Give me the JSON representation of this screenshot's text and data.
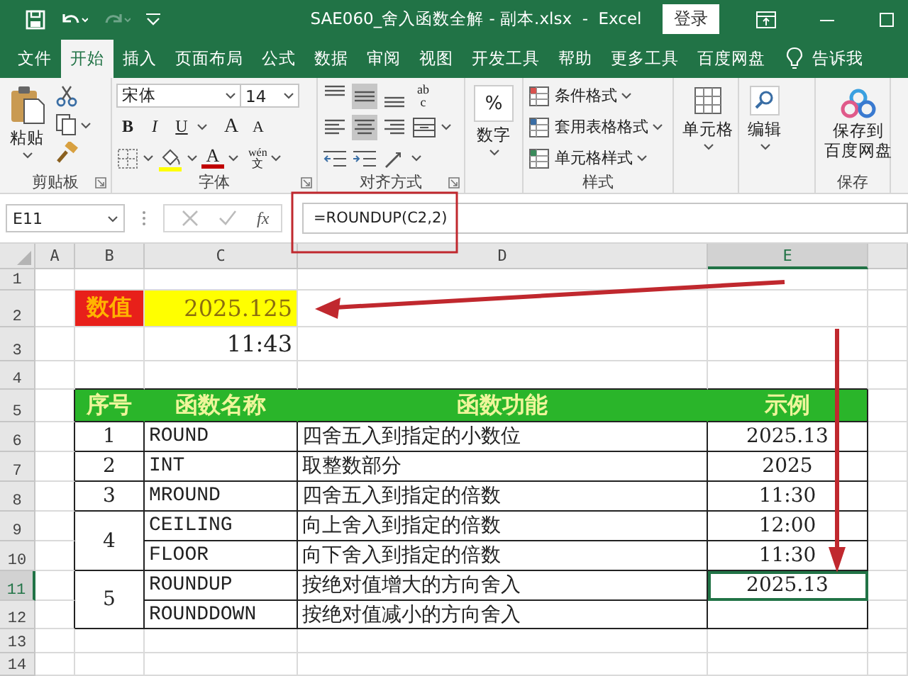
{
  "title_bar": {
    "title": "SAE060_舍入函数全解 - 副本.xlsx  -  Excel",
    "login": "登录"
  },
  "tabs": [
    {
      "label": "文件",
      "selected": false
    },
    {
      "label": "开始",
      "selected": true
    },
    {
      "label": "插入",
      "selected": false
    },
    {
      "label": "页面布局",
      "selected": false
    },
    {
      "label": "公式",
      "selected": false
    },
    {
      "label": "数据",
      "selected": false
    },
    {
      "label": "审阅",
      "selected": false
    },
    {
      "label": "视图",
      "selected": false
    },
    {
      "label": "开发工具",
      "selected": false
    },
    {
      "label": "帮助",
      "selected": false
    },
    {
      "label": "更多工具",
      "selected": false
    },
    {
      "label": "百度网盘",
      "selected": false
    }
  ],
  "tell_me": "告诉我",
  "ribbon": {
    "clipboard": {
      "paste": "粘贴",
      "label": "剪贴板"
    },
    "font": {
      "name": "宋体",
      "size": "14",
      "bold": "B",
      "italic": "I",
      "underline": "U",
      "grow": "A",
      "shrink": "A",
      "font_color": "A",
      "phonetic_top": "wén",
      "phonetic_bottom": "文",
      "label": "字体"
    },
    "alignment": {
      "wrap_top": "ab",
      "wrap_bottom": "c",
      "label": "对齐方式"
    },
    "number": {
      "symbol": "%",
      "button": "数字"
    },
    "styles": {
      "items": [
        "条件格式",
        "套用表格格式",
        "单元格样式"
      ],
      "label": "样式"
    },
    "cells": {
      "button": "单元格"
    },
    "editing": {
      "button": "编辑"
    },
    "save": {
      "button_lines": [
        "保存到",
        "百度网盘"
      ],
      "label": "保存"
    }
  },
  "formula_bar": {
    "name_box": "E11",
    "fx": "fx",
    "formula": "=ROUNDUP(C2,2)"
  },
  "sheet": {
    "columns": [
      {
        "label": "A",
        "selected": false
      },
      {
        "label": "B",
        "selected": false
      },
      {
        "label": "C",
        "selected": false
      },
      {
        "label": "D",
        "selected": false
      },
      {
        "label": "E",
        "selected": true
      }
    ],
    "rows": [
      {
        "label": "1",
        "selected": false
      },
      {
        "label": "2",
        "selected": false
      },
      {
        "label": "3",
        "selected": false
      },
      {
        "label": "4",
        "selected": false
      },
      {
        "label": "5",
        "selected": false
      },
      {
        "label": "6",
        "selected": false
      },
      {
        "label": "7",
        "selected": false
      },
      {
        "label": "8",
        "selected": false
      },
      {
        "label": "9",
        "selected": false
      },
      {
        "label": "10",
        "selected": false
      },
      {
        "label": "11",
        "selected": true
      },
      {
        "label": "12",
        "selected": false
      },
      {
        "label": "13",
        "selected": false
      },
      {
        "label": "14",
        "selected": false
      }
    ],
    "value_label": "数值",
    "value": "2025.125",
    "time": "11:43",
    "table": {
      "columns": [
        "序号",
        "函数名称",
        "函数功能",
        "示例"
      ],
      "groups": [
        {
          "number": "1",
          "functions": [
            {
              "name": "ROUND",
              "description": "四舍五入到指定的小数位",
              "example": "2025.13",
              "selected": false
            }
          ]
        },
        {
          "number": "2",
          "functions": [
            {
              "name": "INT",
              "description": "取整数部分",
              "example": "2025",
              "selected": false
            }
          ]
        },
        {
          "number": "3",
          "functions": [
            {
              "name": "MROUND",
              "description": "四舍五入到指定的倍数",
              "example": "11:30",
              "selected": false
            }
          ]
        },
        {
          "number": "4",
          "functions": [
            {
              "name": "CEILING",
              "description": "向上舍入到指定的倍数",
              "example": "12:00",
              "selected": false
            },
            {
              "name": "FLOOR",
              "description": "向下舍入到指定的倍数",
              "example": "11:30",
              "selected": false
            }
          ]
        },
        {
          "number": "5",
          "functions": [
            {
              "name": "ROUNDUP",
              "description": "按绝对值增大的方向舍入",
              "example": "2025.13",
              "selected": true
            },
            {
              "name": "ROUNDDOWN",
              "description": "按绝对值减小的方向舍入",
              "selected": false
            }
          ]
        }
      ]
    }
  }
}
